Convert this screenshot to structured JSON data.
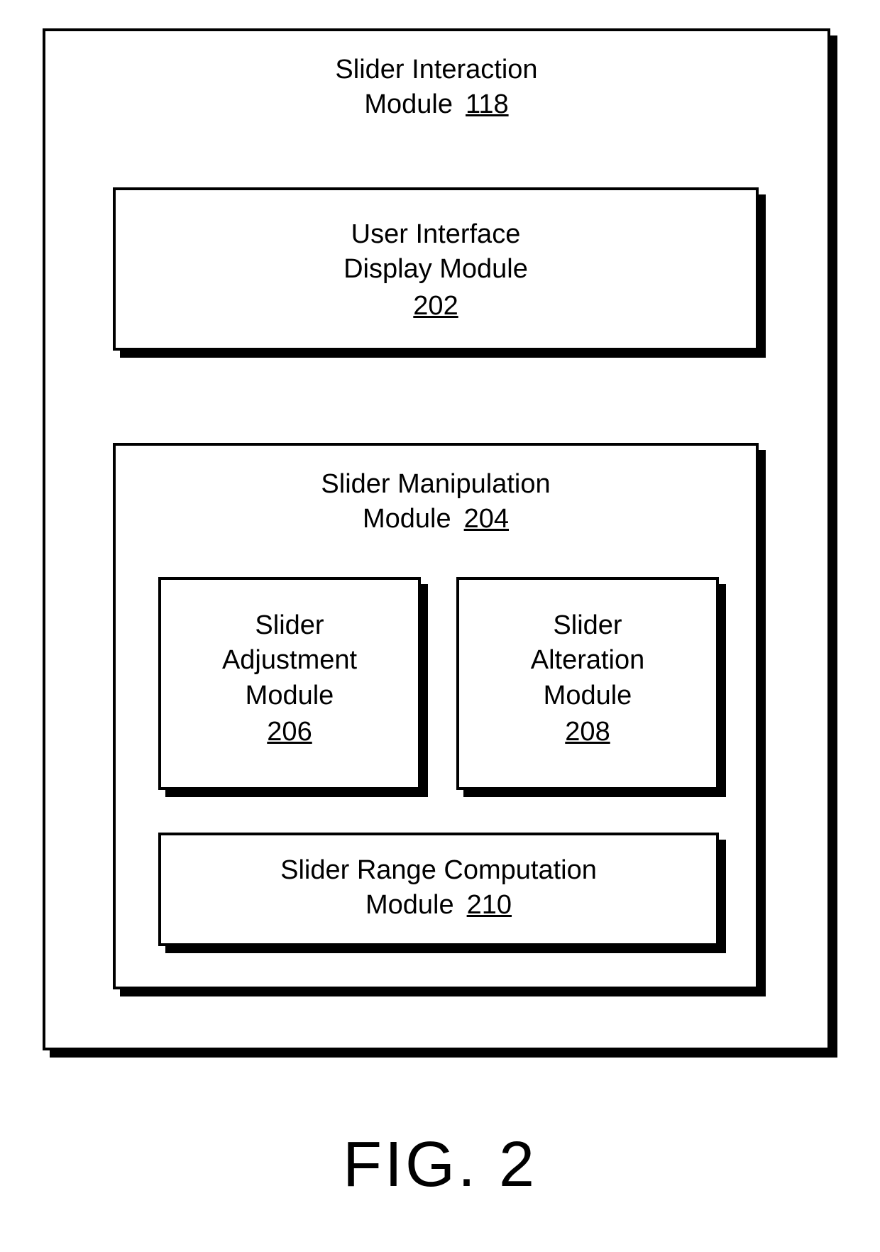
{
  "figure": {
    "label": "FIG. 2"
  },
  "outer": {
    "title_line1": "Slider Interaction",
    "title_line2": "Module",
    "ref": "118"
  },
  "uiDisplay": {
    "line1": "User Interface",
    "line2": "Display Module",
    "ref": "202"
  },
  "manip": {
    "line1": "Slider Manipulation",
    "line2": "Module",
    "ref": "204"
  },
  "adj": {
    "line1": "Slider",
    "line2": "Adjustment",
    "line3": "Module",
    "ref": "206"
  },
  "alt": {
    "line1": "Slider",
    "line2": "Alteration",
    "line3": "Module",
    "ref": "208"
  },
  "range": {
    "line1": "Slider Range Computation",
    "line2": "Module",
    "ref": "210"
  }
}
